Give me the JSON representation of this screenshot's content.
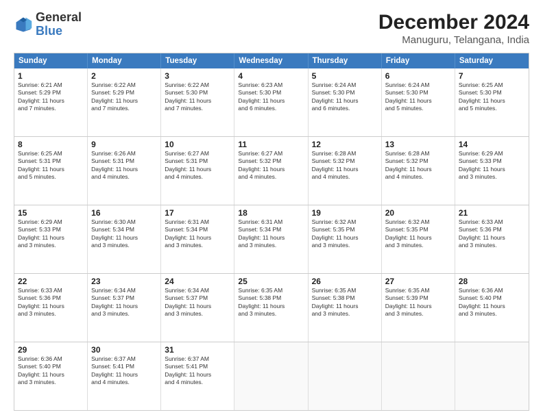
{
  "header": {
    "logo_general": "General",
    "logo_blue": "Blue",
    "title": "December 2024",
    "subtitle": "Manuguru, Telangana, India"
  },
  "weekdays": [
    "Sunday",
    "Monday",
    "Tuesday",
    "Wednesday",
    "Thursday",
    "Friday",
    "Saturday"
  ],
  "weeks": [
    [
      {
        "day": "1",
        "info": "Sunrise: 6:21 AM\nSunset: 5:29 PM\nDaylight: 11 hours\nand 7 minutes."
      },
      {
        "day": "2",
        "info": "Sunrise: 6:22 AM\nSunset: 5:29 PM\nDaylight: 11 hours\nand 7 minutes."
      },
      {
        "day": "3",
        "info": "Sunrise: 6:22 AM\nSunset: 5:30 PM\nDaylight: 11 hours\nand 7 minutes."
      },
      {
        "day": "4",
        "info": "Sunrise: 6:23 AM\nSunset: 5:30 PM\nDaylight: 11 hours\nand 6 minutes."
      },
      {
        "day": "5",
        "info": "Sunrise: 6:24 AM\nSunset: 5:30 PM\nDaylight: 11 hours\nand 6 minutes."
      },
      {
        "day": "6",
        "info": "Sunrise: 6:24 AM\nSunset: 5:30 PM\nDaylight: 11 hours\nand 5 minutes."
      },
      {
        "day": "7",
        "info": "Sunrise: 6:25 AM\nSunset: 5:30 PM\nDaylight: 11 hours\nand 5 minutes."
      }
    ],
    [
      {
        "day": "8",
        "info": "Sunrise: 6:25 AM\nSunset: 5:31 PM\nDaylight: 11 hours\nand 5 minutes."
      },
      {
        "day": "9",
        "info": "Sunrise: 6:26 AM\nSunset: 5:31 PM\nDaylight: 11 hours\nand 4 minutes."
      },
      {
        "day": "10",
        "info": "Sunrise: 6:27 AM\nSunset: 5:31 PM\nDaylight: 11 hours\nand 4 minutes."
      },
      {
        "day": "11",
        "info": "Sunrise: 6:27 AM\nSunset: 5:32 PM\nDaylight: 11 hours\nand 4 minutes."
      },
      {
        "day": "12",
        "info": "Sunrise: 6:28 AM\nSunset: 5:32 PM\nDaylight: 11 hours\nand 4 minutes."
      },
      {
        "day": "13",
        "info": "Sunrise: 6:28 AM\nSunset: 5:32 PM\nDaylight: 11 hours\nand 4 minutes."
      },
      {
        "day": "14",
        "info": "Sunrise: 6:29 AM\nSunset: 5:33 PM\nDaylight: 11 hours\nand 3 minutes."
      }
    ],
    [
      {
        "day": "15",
        "info": "Sunrise: 6:29 AM\nSunset: 5:33 PM\nDaylight: 11 hours\nand 3 minutes."
      },
      {
        "day": "16",
        "info": "Sunrise: 6:30 AM\nSunset: 5:34 PM\nDaylight: 11 hours\nand 3 minutes."
      },
      {
        "day": "17",
        "info": "Sunrise: 6:31 AM\nSunset: 5:34 PM\nDaylight: 11 hours\nand 3 minutes."
      },
      {
        "day": "18",
        "info": "Sunrise: 6:31 AM\nSunset: 5:34 PM\nDaylight: 11 hours\nand 3 minutes."
      },
      {
        "day": "19",
        "info": "Sunrise: 6:32 AM\nSunset: 5:35 PM\nDaylight: 11 hours\nand 3 minutes."
      },
      {
        "day": "20",
        "info": "Sunrise: 6:32 AM\nSunset: 5:35 PM\nDaylight: 11 hours\nand 3 minutes."
      },
      {
        "day": "21",
        "info": "Sunrise: 6:33 AM\nSunset: 5:36 PM\nDaylight: 11 hours\nand 3 minutes."
      }
    ],
    [
      {
        "day": "22",
        "info": "Sunrise: 6:33 AM\nSunset: 5:36 PM\nDaylight: 11 hours\nand 3 minutes."
      },
      {
        "day": "23",
        "info": "Sunrise: 6:34 AM\nSunset: 5:37 PM\nDaylight: 11 hours\nand 3 minutes."
      },
      {
        "day": "24",
        "info": "Sunrise: 6:34 AM\nSunset: 5:37 PM\nDaylight: 11 hours\nand 3 minutes."
      },
      {
        "day": "25",
        "info": "Sunrise: 6:35 AM\nSunset: 5:38 PM\nDaylight: 11 hours\nand 3 minutes."
      },
      {
        "day": "26",
        "info": "Sunrise: 6:35 AM\nSunset: 5:38 PM\nDaylight: 11 hours\nand 3 minutes."
      },
      {
        "day": "27",
        "info": "Sunrise: 6:35 AM\nSunset: 5:39 PM\nDaylight: 11 hours\nand 3 minutes."
      },
      {
        "day": "28",
        "info": "Sunrise: 6:36 AM\nSunset: 5:40 PM\nDaylight: 11 hours\nand 3 minutes."
      }
    ],
    [
      {
        "day": "29",
        "info": "Sunrise: 6:36 AM\nSunset: 5:40 PM\nDaylight: 11 hours\nand 3 minutes."
      },
      {
        "day": "30",
        "info": "Sunrise: 6:37 AM\nSunset: 5:41 PM\nDaylight: 11 hours\nand 4 minutes."
      },
      {
        "day": "31",
        "info": "Sunrise: 6:37 AM\nSunset: 5:41 PM\nDaylight: 11 hours\nand 4 minutes."
      },
      {
        "day": "",
        "info": ""
      },
      {
        "day": "",
        "info": ""
      },
      {
        "day": "",
        "info": ""
      },
      {
        "day": "",
        "info": ""
      }
    ]
  ]
}
